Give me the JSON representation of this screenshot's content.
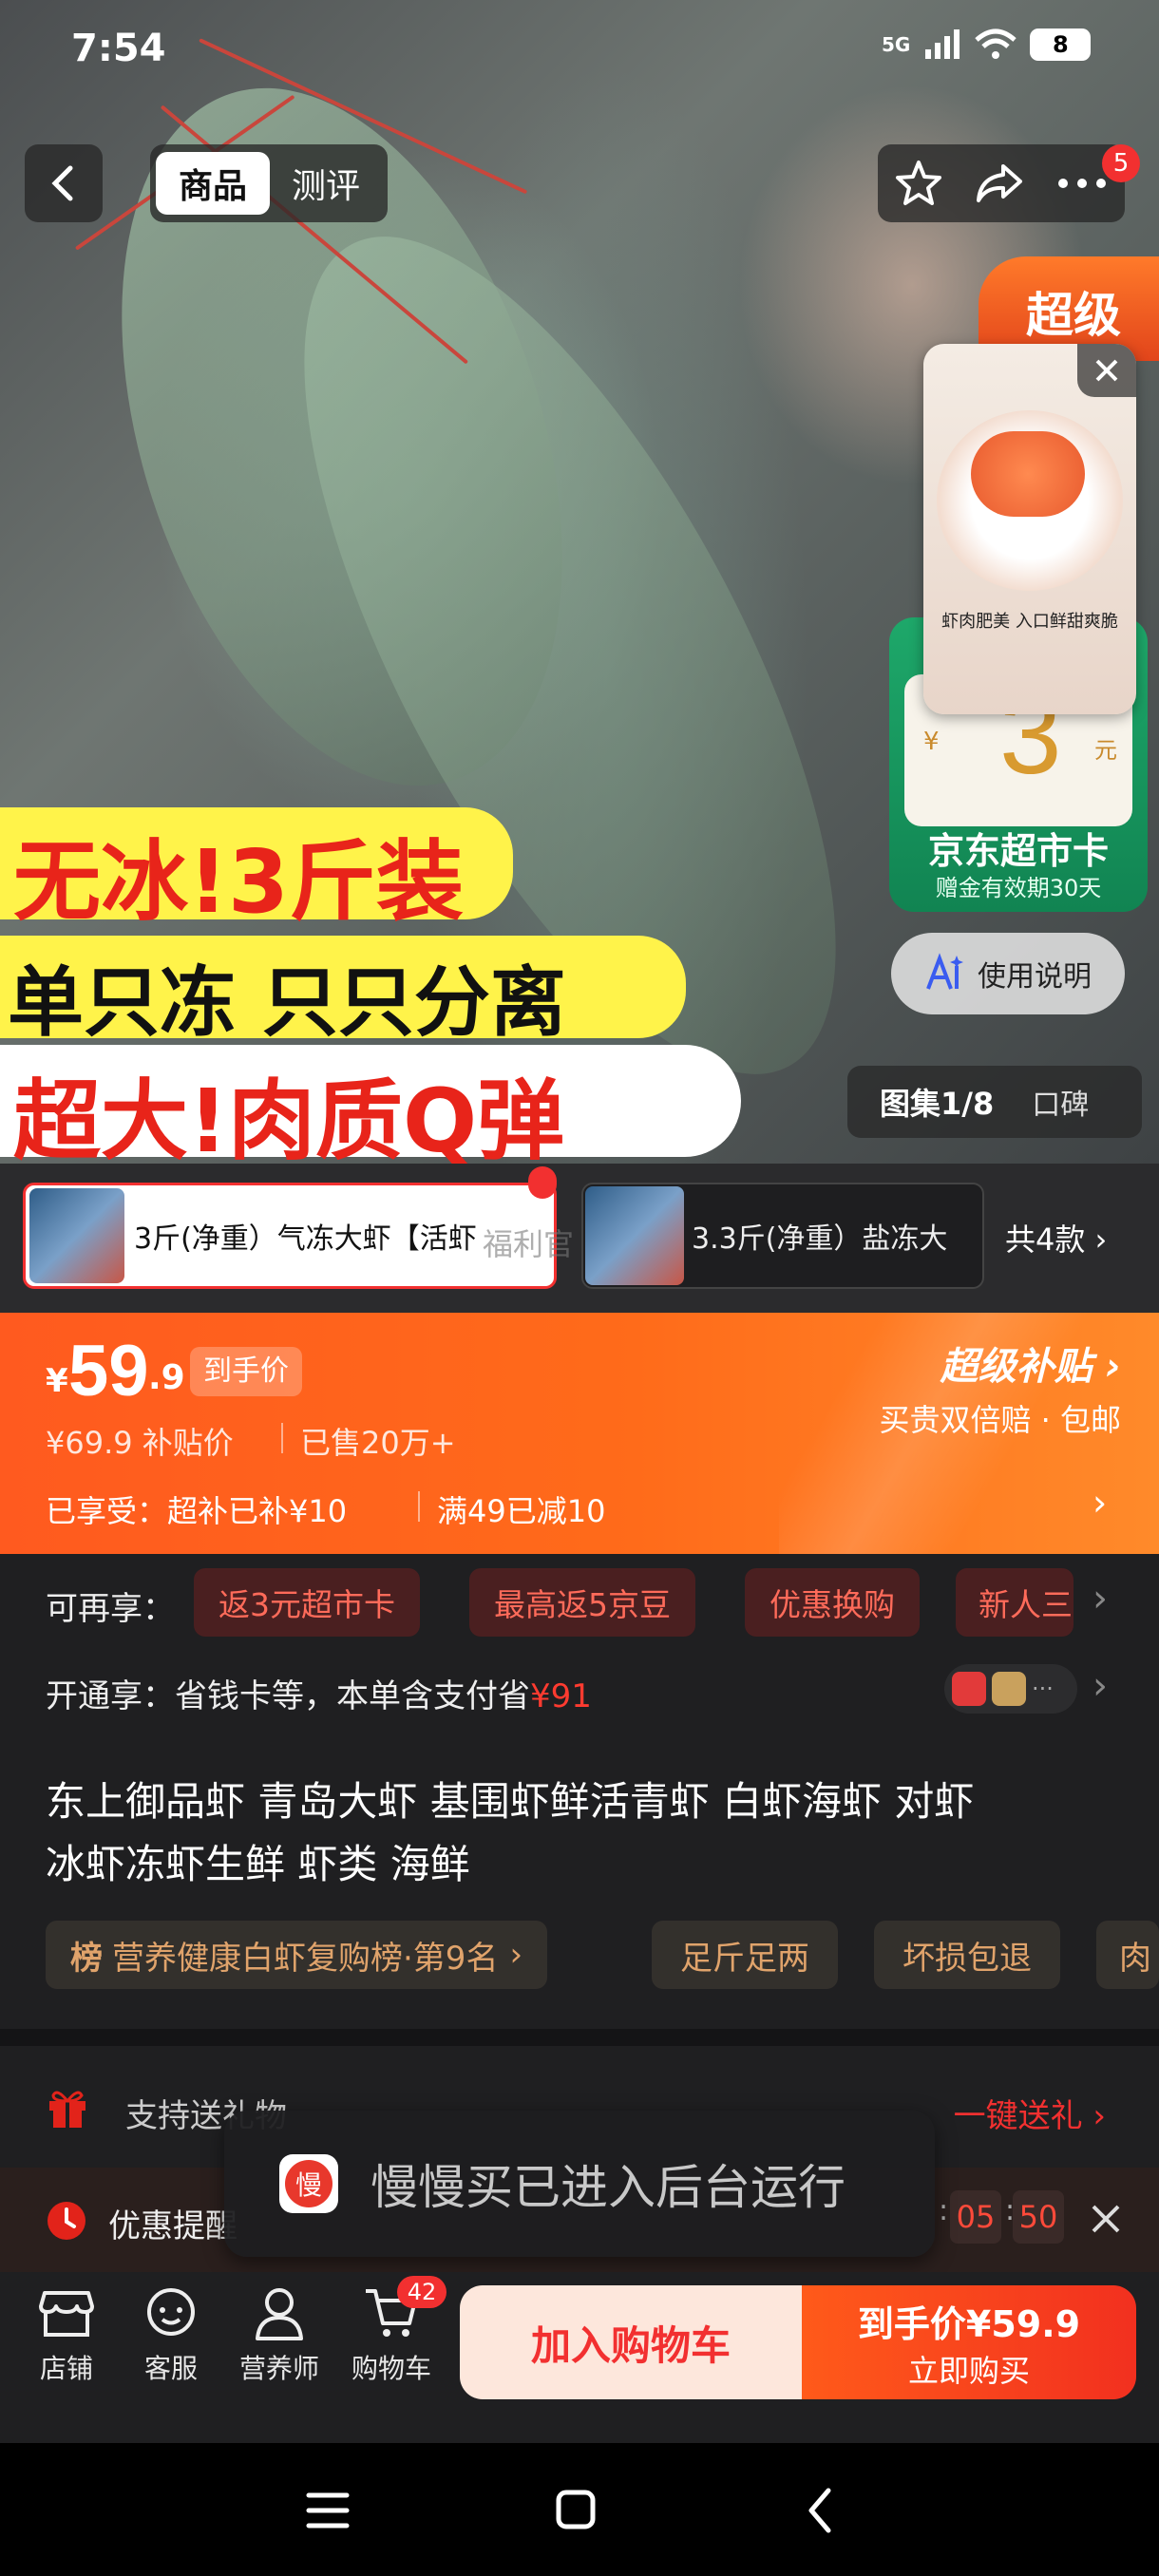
{
  "status": {
    "time": "7:54",
    "network": "5G",
    "battery": "8"
  },
  "header": {
    "tabs": [
      "商品",
      "测评"
    ],
    "badge_count": "5"
  },
  "hero": {
    "promo_line1": "无冰!3斤装",
    "promo_line2": "单只冻 只只分离",
    "promo_line3": "超大!肉质Q弹",
    "super_label": "超级",
    "popup_caption": "虾肉肥美 入口鲜甜爽脆",
    "card_value": "3",
    "card_currency": "¥",
    "card_unit": "元",
    "card_name": "京东超市卡",
    "card_note": "赠金有效期30天",
    "usage_button": "使用说明",
    "gallery_label": "图集1/8",
    "reviews_label": "口碑"
  },
  "variants": {
    "item1_label": "3斤(净重）气冻大虾【活虾",
    "item2_label": "3.3斤(净重）盐冻大",
    "total": "共4款",
    "overlay": "福利官"
  },
  "price": {
    "currency": "¥",
    "integer": "59",
    "decimal": ".9",
    "badge": "到手价",
    "original": "¥69.9 补贴价",
    "sold": "已售20万+",
    "enjoyed": "已享受：超补已补¥10",
    "discount": "满49已减10",
    "promo_title": "超级补贴",
    "promo_sub": "买贵双倍赔 · 包邮"
  },
  "more": {
    "label": "可再享：",
    "chips": [
      "返3元超市卡",
      "最高返5京豆",
      "优惠换购",
      "新人三"
    ],
    "open_label": "开通享：省钱卡等，本单含支付省",
    "open_amount": "¥91"
  },
  "title": {
    "line1": "东上御品虾 青岛大虾 基围虾鲜活青虾 白虾海虾 对虾",
    "line2": "冰虾冻虾生鲜 虾类 海鲜"
  },
  "tags": {
    "rank_prefix": "榜",
    "rank": "营养健康白虾复购榜·第9名",
    "items": [
      "足斤足两",
      "坏损包退",
      "肉"
    ]
  },
  "gift": {
    "label": "支持送礼物",
    "action": "一键送礼"
  },
  "reminder": {
    "label": "优惠提醒",
    "min": "05",
    "sec": "50"
  },
  "toast": {
    "icon_char": "慢",
    "text": "慢慢买已进入后台运行"
  },
  "bottom": {
    "store": "店铺",
    "service": "客服",
    "nutrition": "营养师",
    "cart": "购物车",
    "cart_count": "42",
    "add_cart": "加入购物车",
    "buy_title": "到手价¥59.9",
    "buy_sub": "立即购买"
  },
  "colors": {
    "accent": "#f23030",
    "orange": "#ff6a00",
    "gold": "#e0a36b"
  }
}
